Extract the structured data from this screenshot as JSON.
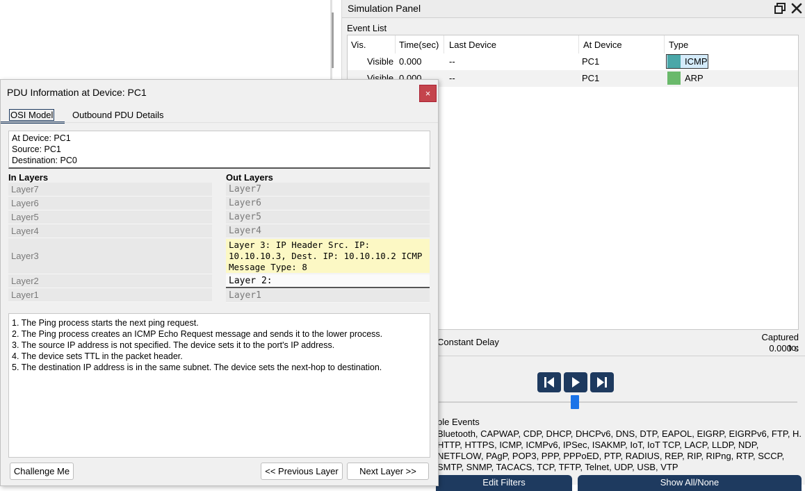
{
  "simulation_panel": {
    "title": "Simulation Panel",
    "event_list_label": "Event List",
    "columns": [
      "Vis.",
      "Time(sec)",
      "Last Device",
      "At Device",
      "Type"
    ],
    "events": [
      {
        "vis": "Visible",
        "time": "0.000",
        "last_device": "--",
        "at_device": "PC1",
        "type": "ICMP",
        "color": "#4aa7a8",
        "selected": true
      },
      {
        "vis": "Visible",
        "time": "0.000",
        "last_device": "--",
        "at_device": "PC1",
        "type": "ARP",
        "color": "#6ab96b",
        "selected": false
      }
    ],
    "constant_delay_label": "Constant Delay",
    "captured_label": "Captured to:",
    "captured_value": "0.000 s",
    "visible_events_label": "ble Events",
    "visible_events_text": "Bluetooth, CAPWAP, CDP, DHCP, DHCPv6, DNS, DTP, EAPOL, EIGRP, EIGRPv6, FTP, H. HTTP, HTTPS, ICMP, ICMPv6, IPSec, ISAKMP, IoT, IoT TCP, LACP, LLDP, NDP, NETFLOW, PAgP, POP3, PPP, PPPoED, PTP, RADIUS, REP, RIP, RIPng, RTP, SCCP, SMTP, SNMP, TACACS, TCP, TFTP, Telnet, UDP, USB, VTP",
    "edit_filters_label": "Edit Filters",
    "show_all_label": "Show All/None",
    "accent_color": "#1e3a5f",
    "slider_color": "#1a73e8"
  },
  "pdu_dialog": {
    "title": "PDU Information at Device: PC1",
    "close_label": "×",
    "tabs": [
      "OSI Model",
      "Outbound PDU Details"
    ],
    "info": [
      "At Device: PC1",
      "Source: PC1",
      "Destination: PC0"
    ],
    "in_layers_title": "In Layers",
    "out_layers_title": "Out Layers",
    "in_layers": [
      "Layer7",
      "Layer6",
      "Layer5",
      "Layer4",
      "Layer3",
      "Layer2",
      "Layer1"
    ],
    "out_layers": [
      "Layer7",
      "Layer6",
      "Layer5",
      "Layer4",
      "Layer 3: IP Header Src. IP: 10.10.10.3, Dest. IP: 10.10.10.2 ICMP Message Type: 8",
      "Layer 2:",
      "Layer1"
    ],
    "description": [
      "1. The Ping process starts the next ping request.",
      "2. The Ping process creates an ICMP Echo Request message and sends it to the lower process.",
      "3. The source IP address is not specified. The device sets it to the port's IP address.",
      "4. The device sets TTL in the packet header.",
      "5. The destination IP address is in the same subnet. The device sets the next-hop to destination."
    ],
    "buttons": {
      "challenge": "Challenge Me",
      "previous": "<< Previous Layer",
      "next": "Next Layer >>"
    },
    "highlight_color": "#fcf8c4",
    "close_color": "#c4444c"
  }
}
